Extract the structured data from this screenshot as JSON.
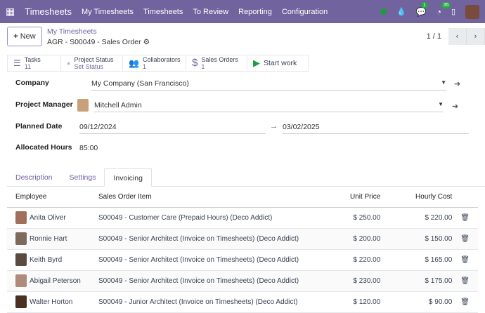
{
  "nav": {
    "app": "Timesheets",
    "menus": [
      "My Timesheets",
      "Timesheets",
      "To Review",
      "Reporting",
      "Configuration"
    ],
    "messages_count": "1",
    "activities_count": "35"
  },
  "control": {
    "new_label": "New",
    "breadcrumb_parent": "My Timesheets",
    "breadcrumb_current": "AGR - S00049 - Sales Order",
    "pager": "1 / 1"
  },
  "buttons": {
    "tasks_label": "Tasks",
    "tasks_value": "11",
    "status_label": "Project Status",
    "status_value": "Set Status",
    "collab_label": "Collaborators",
    "collab_value": "1",
    "so_label": "Sales Orders",
    "so_value": "1",
    "start_work": "Start work"
  },
  "form": {
    "company_label": "Company",
    "company": "My Company (San Francisco)",
    "pm_label": "Project Manager",
    "pm": "Mitchell Admin",
    "date_label": "Planned Date",
    "date_start": "09/12/2024",
    "date_end": "03/02/2025",
    "hours_label": "Allocated Hours",
    "hours": "85:00"
  },
  "tabs": [
    "Description",
    "Settings",
    "Invoicing"
  ],
  "table": {
    "headers": [
      "Employee",
      "Sales Order Item",
      "Unit Price",
      "Hourly Cost"
    ],
    "rows": [
      {
        "employee": "Anita Oliver",
        "item": "S00049 - Customer Care (Prepaid Hours) (Deco Addict)",
        "price": "$ 250.00",
        "cost": "$ 220.00"
      },
      {
        "employee": "Ronnie Hart",
        "item": "S00049 - Senior Architect (Invoice on Timesheets) (Deco Addict)",
        "price": "$ 200.00",
        "cost": "$ 150.00"
      },
      {
        "employee": "Keith Byrd",
        "item": "S00049 - Senior Architect (Invoice on Timesheets) (Deco Addict)",
        "price": "$ 220.00",
        "cost": "$ 165.00"
      },
      {
        "employee": "Abigail Peterson",
        "item": "S00049 - Senior Architect (Invoice on Timesheets) (Deco Addict)",
        "price": "$ 230.00",
        "cost": "$ 175.00"
      },
      {
        "employee": "Walter Horton",
        "item": "S00049 - Junior Architect (Invoice on Timesheets) (Deco Addict)",
        "price": "$ 120.00",
        "cost": "$ 90.00"
      }
    ]
  }
}
